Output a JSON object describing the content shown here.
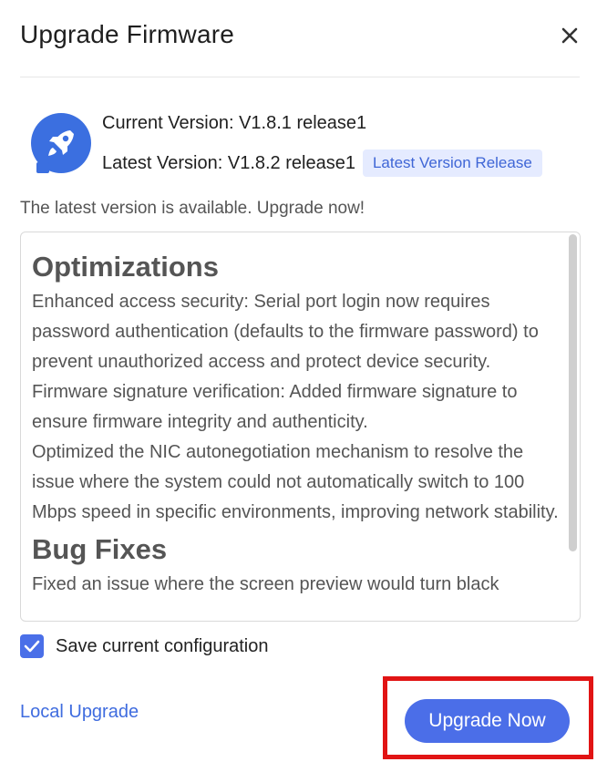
{
  "dialog": {
    "title": "Upgrade Firmware",
    "close_icon": "close-icon"
  },
  "versions": {
    "current_label": "Current Version: V1.8.1 release1",
    "latest_label": "Latest Version: V1.8.2 release1",
    "latest_badge": "Latest Version Release",
    "icon": "rocket-icon"
  },
  "availability_text": "The latest version is available. Upgrade now!",
  "release_notes": {
    "sections": [
      {
        "heading": "Optimizations",
        "items": [
          "Enhanced access security: Serial port login now requires password authentication (defaults to the firmware password) to prevent unauthorized access and protect device security.",
          "Firmware signature verification: Added firmware signature to ensure firmware integrity and authenticity.",
          "Optimized the NIC autonegotiation mechanism to resolve the issue where the system could not automatically switch to 100 Mbps speed in specific environments, improving network stability."
        ]
      },
      {
        "heading": "Bug Fixes",
        "items": [
          "Fixed an issue where the screen preview would turn black"
        ]
      }
    ]
  },
  "options": {
    "save_config_label": "Save current configuration",
    "save_config_checked": true
  },
  "footer": {
    "local_upgrade_label": "Local Upgrade",
    "upgrade_now_label": "Upgrade Now"
  },
  "colors": {
    "accent": "#4b6ee8",
    "link": "#3f6cdf",
    "badge_bg": "#e5ebff",
    "highlight": "#e11414"
  }
}
